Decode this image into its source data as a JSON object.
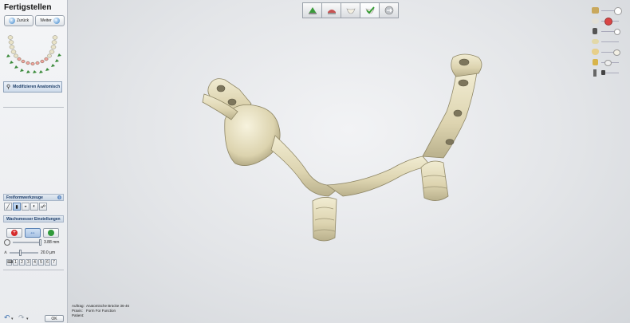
{
  "panel": {
    "title": "Fertigstellen",
    "back_label": "Zurück",
    "next_label": "Weiter",
    "modify_label": "Modifizieren Anatomisch",
    "freeform_header": "Freiformwerkzeuge",
    "wax_header": "Wachsmesser Einstellungen",
    "value1": "3.88 mm",
    "value2": "20.0 µm",
    "numbers": [
      "1",
      "2",
      "3",
      "4",
      "5",
      "6",
      "7"
    ],
    "ok_label": "OK"
  },
  "info": {
    "auftrag_key": "Auftrag:",
    "auftrag_val": "Anatomische Brücke 36-46",
    "praxis_key": "Praxis:",
    "praxis_val": "Form For Function",
    "patient_key": "Patient:",
    "patient_val": ""
  },
  "colors": {
    "model": "#e4dcbc",
    "accent": "#3c86c9"
  }
}
